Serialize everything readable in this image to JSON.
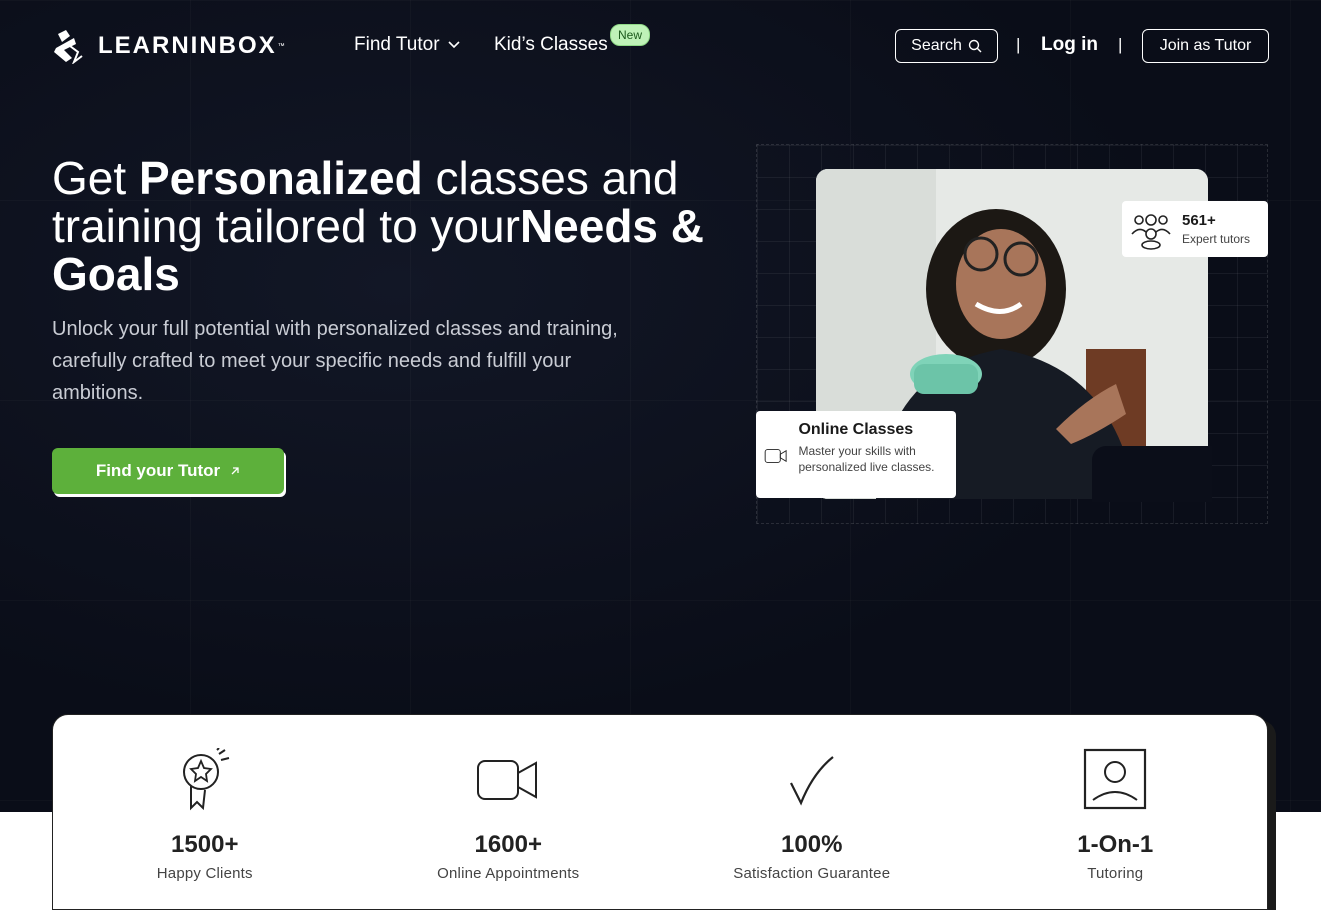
{
  "header": {
    "logo_text": "LEARNINBOX",
    "logo_tm": "™",
    "nav": {
      "find_tutor": "Find Tutor",
      "kids_classes": "Kid’s Classes",
      "new_badge": "New"
    },
    "search_label": "Search",
    "login_label": "Log in",
    "join_label": "Join as Tutor",
    "separator": "|"
  },
  "hero": {
    "headline": {
      "part1": "Get ",
      "bold1": "Personalized",
      "part2": " classes and training tailored to your",
      "bold2": "Needs & Goals"
    },
    "subtext": "Unlock your full potential with personalized classes and training, carefully crafted to meet your specific needs and fulfill your ambitions.",
    "cta_label": "Find your Tutor",
    "cta_icon": "arrow-up-right-icon"
  },
  "cards": {
    "tutors": {
      "count": "561+",
      "label": "Expert tutors",
      "icon": "users-icon"
    },
    "online": {
      "title": "Online Classes",
      "description": "Master your skills with personalized live classes.",
      "icon": "video-camera-icon"
    }
  },
  "stats": [
    {
      "value": "1500+",
      "caption": "Happy Clients",
      "icon": "award-badge-icon"
    },
    {
      "value": "1600+",
      "caption": "Online Appointments",
      "icon": "video-camera-icon"
    },
    {
      "value": "100%",
      "caption": "Satisfaction Guarantee",
      "icon": "checkmark-icon"
    },
    {
      "value": "1-On-1",
      "caption": "Tutoring",
      "icon": "user-portrait-icon"
    }
  ],
  "colors": {
    "background": "#0a0d18",
    "accent_green": "#5db03b",
    "badge_green": "#bff2b8",
    "text_white": "#ffffff"
  }
}
